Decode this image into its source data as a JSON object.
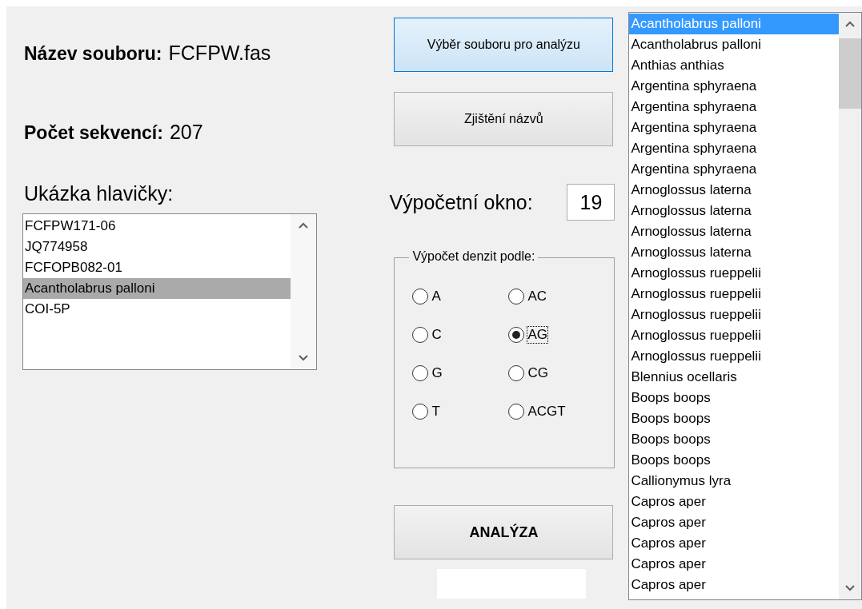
{
  "file_name": {
    "label": "Název souboru:",
    "value": "FCFPW.fas"
  },
  "sequence_count": {
    "label": "Počet sekvencí:",
    "value": "207"
  },
  "header_preview": {
    "label": "Ukázka hlavičky:",
    "items": [
      {
        "text": "FCFPW171-06",
        "selected": false
      },
      {
        "text": "JQ774958",
        "selected": false
      },
      {
        "text": "FCFOPB082-01",
        "selected": false
      },
      {
        "text": "Acantholabrus palloni",
        "selected": true
      },
      {
        "text": "COI-5P",
        "selected": false
      }
    ]
  },
  "buttons": [
    {
      "label": "Výběr souboru pro analýzu",
      "focused": true
    },
    {
      "label": "Zjištění názvů",
      "focused": false
    }
  ],
  "window_field": {
    "label": "Výpočetní okno:",
    "value": "19"
  },
  "density_group": {
    "title": "Výpočet denzit podle:",
    "options": [
      {
        "label": "A",
        "selected": false
      },
      {
        "label": "AC",
        "selected": false
      },
      {
        "label": "C",
        "selected": false
      },
      {
        "label": "AG",
        "selected": true
      },
      {
        "label": "G",
        "selected": false
      },
      {
        "label": "CG",
        "selected": false
      },
      {
        "label": "T",
        "selected": false
      },
      {
        "label": "ACGT",
        "selected": false
      }
    ]
  },
  "analyze_button": {
    "label": "ANALÝZA"
  },
  "species_list": [
    {
      "text": "Acantholabrus palloni",
      "selected": true
    },
    {
      "text": "Acantholabrus palloni",
      "selected": false
    },
    {
      "text": "Anthias anthias",
      "selected": false
    },
    {
      "text": "Argentina sphyraena",
      "selected": false
    },
    {
      "text": "Argentina sphyraena",
      "selected": false
    },
    {
      "text": "Argentina sphyraena",
      "selected": false
    },
    {
      "text": "Argentina sphyraena",
      "selected": false
    },
    {
      "text": "Argentina sphyraena",
      "selected": false
    },
    {
      "text": "Arnoglossus laterna",
      "selected": false
    },
    {
      "text": "Arnoglossus laterna",
      "selected": false
    },
    {
      "text": "Arnoglossus laterna",
      "selected": false
    },
    {
      "text": "Arnoglossus laterna",
      "selected": false
    },
    {
      "text": "Arnoglossus rueppelii",
      "selected": false
    },
    {
      "text": "Arnoglossus rueppelii",
      "selected": false
    },
    {
      "text": "Arnoglossus rueppelii",
      "selected": false
    },
    {
      "text": "Arnoglossus rueppelii",
      "selected": false
    },
    {
      "text": "Arnoglossus rueppelii",
      "selected": false
    },
    {
      "text": "Blennius ocellaris",
      "selected": false
    },
    {
      "text": "Boops boops",
      "selected": false
    },
    {
      "text": "Boops boops",
      "selected": false
    },
    {
      "text": "Boops boops",
      "selected": false
    },
    {
      "text": "Boops boops",
      "selected": false
    },
    {
      "text": "Callionymus lyra",
      "selected": false
    },
    {
      "text": "Capros aper",
      "selected": false
    },
    {
      "text": "Capros aper",
      "selected": false
    },
    {
      "text": "Capros aper",
      "selected": false
    },
    {
      "text": "Capros aper",
      "selected": false
    },
    {
      "text": "Capros aper",
      "selected": false
    }
  ]
}
